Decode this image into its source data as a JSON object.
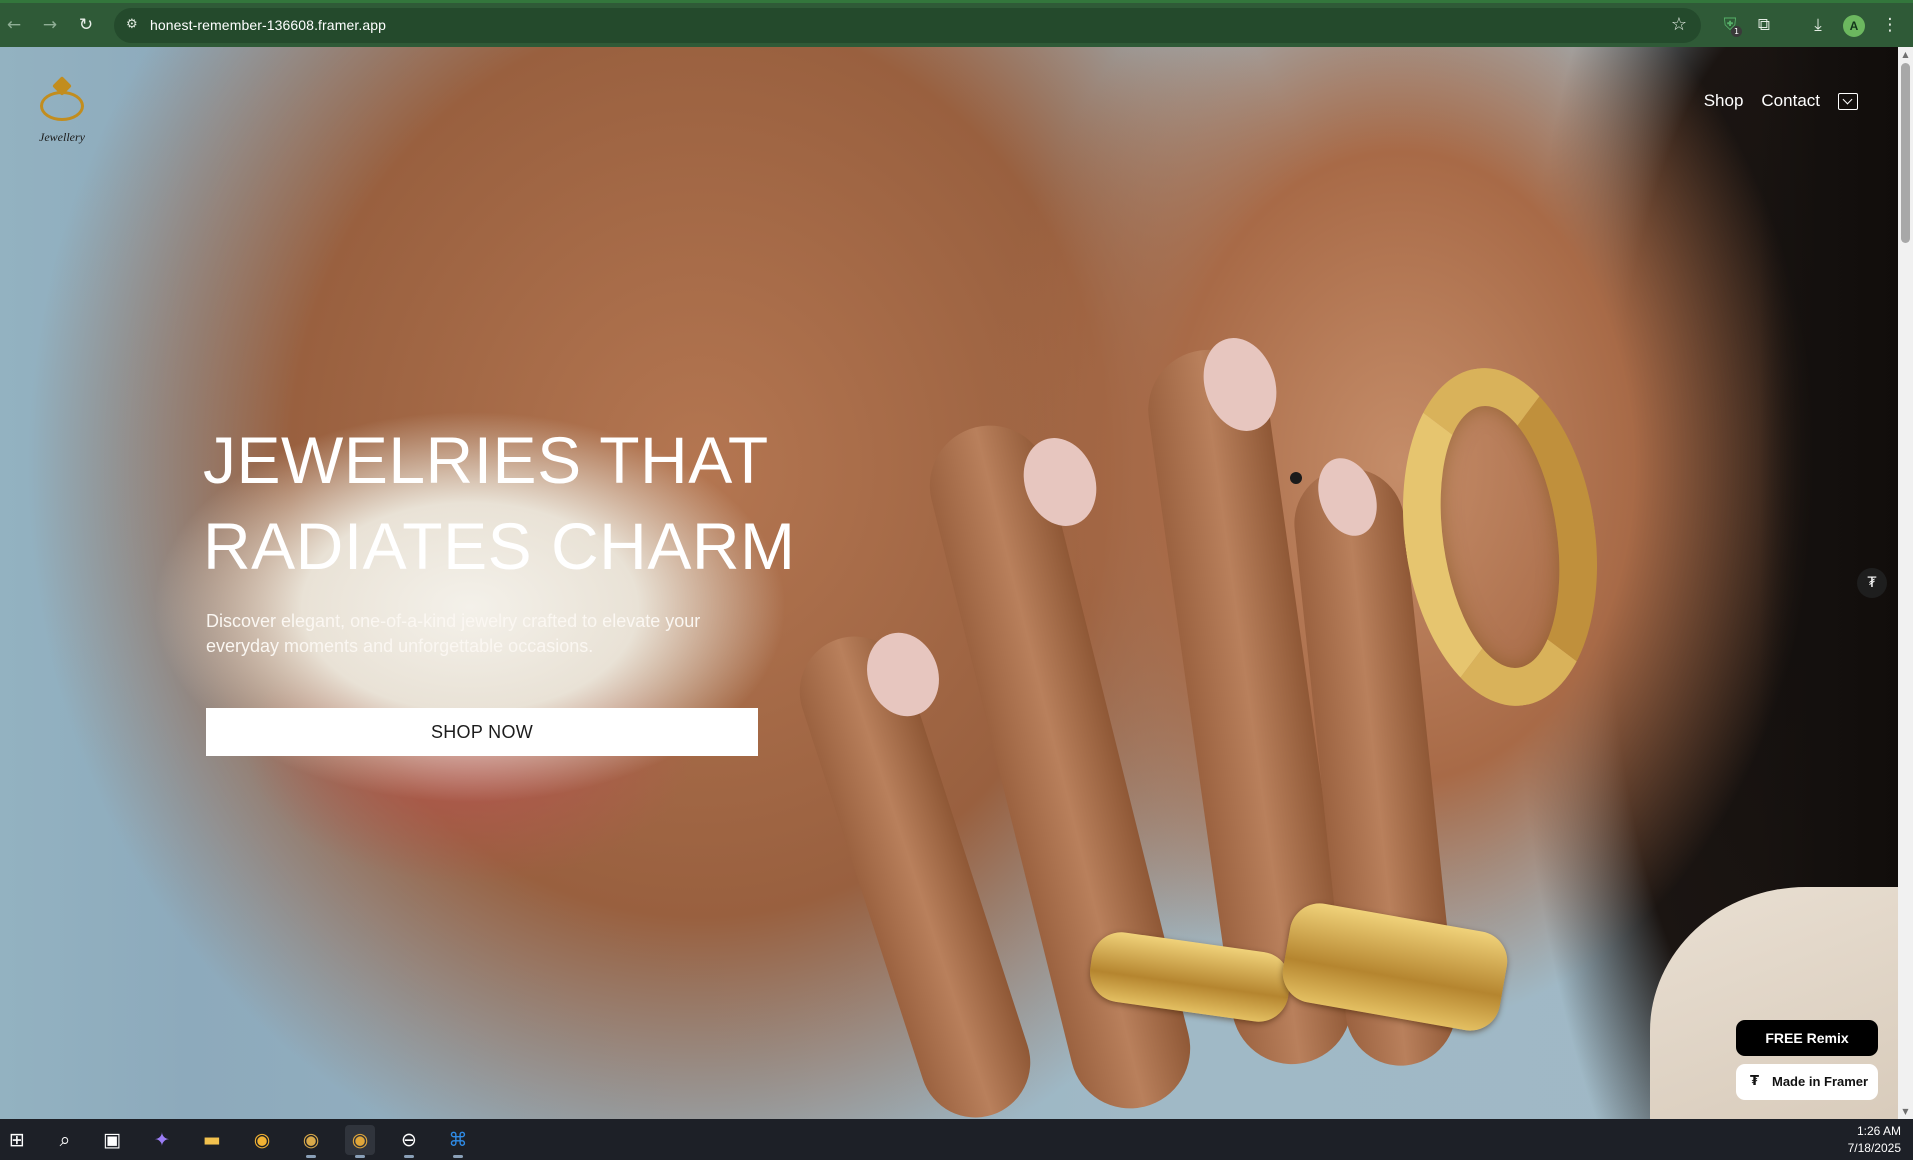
{
  "browser": {
    "url": "honest-remember-136608.framer.app",
    "extension_badge": "1",
    "profile_initial": "A"
  },
  "site": {
    "logo_text": "Jewellery",
    "nav": {
      "shop": "Shop",
      "contact": "Contact"
    },
    "hero": {
      "title_line1": "JEWELRIES THAT",
      "title_line2": "RADIATES CHARM",
      "subtitle": "Discover elegant, one-of-a-kind jewelry crafted to elevate your everyday moments and unforgettable occasions.",
      "cta": "SHOP NOW"
    },
    "framer": {
      "remix": "FREE Remix",
      "made_in": "Made in Framer"
    }
  },
  "taskbar": {
    "time": "1:26 AM",
    "date": "7/18/2025"
  },
  "colors": {
    "chrome_bg": "#2f5a37",
    "logo_gold": "#c28d1e",
    "cta_bg": "#ffffff",
    "remix_bg": "#000000"
  },
  "icons": [
    "back-icon",
    "forward-icon",
    "reload-icon",
    "site-info-icon",
    "bookmark-star-icon",
    "shield-extension-icon",
    "puzzle-extensions-icon",
    "download-icon",
    "menu-dots-icon",
    "cart-icon",
    "framer-icon",
    "windows-start-icon",
    "search-icon",
    "task-view-icon",
    "copilot-icon",
    "file-explorer-icon",
    "chrome-icon",
    "vscode-icon"
  ]
}
